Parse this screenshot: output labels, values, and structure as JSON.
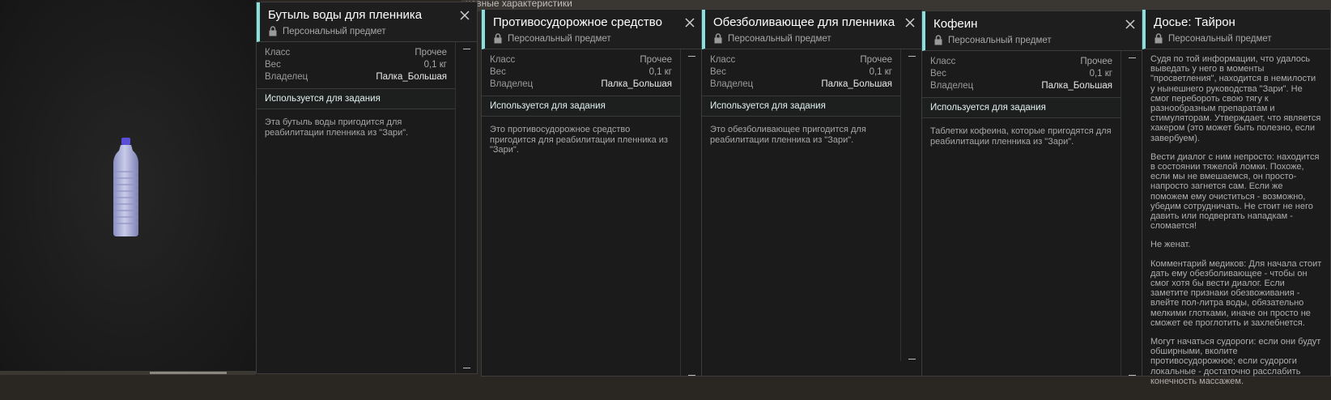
{
  "background": {
    "partial_text": "новные характеристики"
  },
  "preview": {
    "item_image": "water-bottle"
  },
  "panels": [
    {
      "title": "Бутыль воды для пленника",
      "subtitle": "Персональный предмет",
      "props": {
        "class_label": "Класс",
        "class_value": "Прочее",
        "weight_label": "Вес",
        "weight_value": "0,1 кг",
        "owner_label": "Владелец",
        "owner_value": "Палка_Большая"
      },
      "task_label": "Используется для задания",
      "description": "Эта бутыль воды пригодится для реабилитации пленника из \"Зари\"."
    },
    {
      "title": "Противосудорожное средство",
      "subtitle": "Персональный предмет",
      "props": {
        "class_label": "Класс",
        "class_value": "Прочее",
        "weight_label": "Вес",
        "weight_value": "0,1 кг",
        "owner_label": "Владелец",
        "owner_value": "Палка_Большая"
      },
      "task_label": "Используется для задания",
      "description": "Это противосудорожное средство пригодится для реабилитации пленника из \"Зари\"."
    },
    {
      "title": "Обезболивающее для пленника",
      "subtitle": "Персональный предмет",
      "props": {
        "class_label": "Класс",
        "class_value": "Прочее",
        "weight_label": "Вес",
        "weight_value": "0,1 кг",
        "owner_label": "Владелец",
        "owner_value": "Палка_Большая"
      },
      "task_label": "Используется для задания",
      "description": "Это обезболивающее пригодится для реабилитации пленника из \"Зари\"."
    },
    {
      "title": "Кофеин",
      "subtitle": "Персональный предмет",
      "props": {
        "class_label": "Класс",
        "class_value": "Прочее",
        "weight_label": "Вес",
        "weight_value": "0,1 кг",
        "owner_label": "Владелец",
        "owner_value": "Палка_Большая"
      },
      "task_label": "Используется для задания",
      "description": "Таблетки кофеина, которые пригодятся для реабилитации пленника из \"Зари\"."
    }
  ],
  "dossier": {
    "title": "Досье: Тайрон",
    "subtitle": "Персональный предмет",
    "paragraphs": [
      "Судя по той информации, что удалось выведать у него в моменты \"просветления\", находится в немилости у нынешнего руководства \"Зари\". Не смог перебороть свою тягу к разнообразным препаратам и стимуляторам. Утверждает, что является хакером (это может быть полезно, если завербуем).",
      "Вести диалог с ним непросто: находится в состоянии тяжелой ломки. Похоже, если мы не вмешаемся, он просто-напросто загнется сам. Если же поможем ему очиститься - возможно, убедим сотрудничать. Не стоит не него давить или подвергать нападкам - сломается!",
      "Не женат.",
      "Комментарий медиков: Для начала стоит дать ему обезболивающее - чтобы он смог хотя бы вести диалог. Если заметите признаки обезвоживания - влейте пол-литра воды, обязательно мелкими глотками, иначе он просто не сможет ее проглотить и захлебнется.",
      "Могут начаться судороги: если они будут обширными, вколите противосудорожное; если судороги локальные - достаточно расслабить конечность массажем."
    ]
  }
}
